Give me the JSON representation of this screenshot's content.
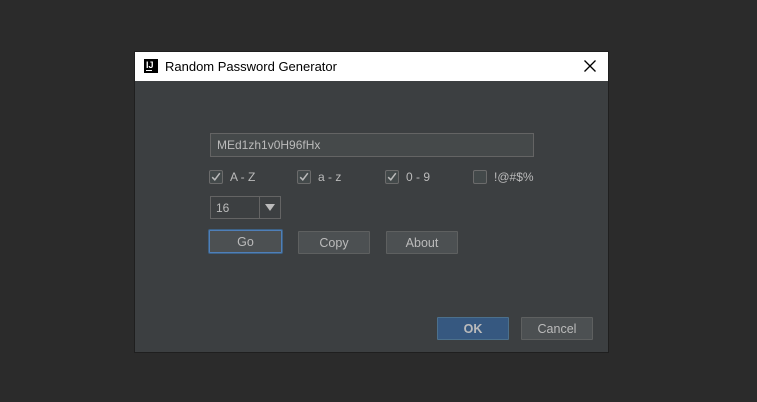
{
  "dialog": {
    "title": "Random Password Generator",
    "app_icon_text": "IJ"
  },
  "password": {
    "value": "MEd1zh1v0H96fHx"
  },
  "options": [
    {
      "label": "A - Z",
      "checked": true
    },
    {
      "label": "a - z",
      "checked": true
    },
    {
      "label": "0 - 9",
      "checked": true
    },
    {
      "label": "!@#$%",
      "checked": false
    }
  ],
  "length": {
    "selected": "16"
  },
  "actions": {
    "go": "Go",
    "copy": "Copy",
    "about": "About"
  },
  "footer": {
    "ok": "OK",
    "cancel": "Cancel"
  },
  "colors": {
    "background": "#2b2b2b",
    "dialog_bg": "#3c3f41",
    "primary_button": "#365880",
    "focus_border": "#4f7fb8"
  }
}
